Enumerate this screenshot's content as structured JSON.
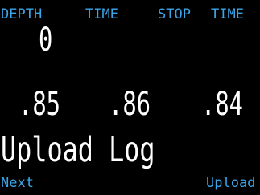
{
  "header": {
    "depth_label": "DEPTH",
    "time_label": "TIME",
    "stop_label": "STOP",
    "time2_label": "TIME"
  },
  "depth": {
    "value": "0"
  },
  "readings": [
    ".85",
    ".86",
    ".84"
  ],
  "message": "Upload Log",
  "softkeys": {
    "left": "Next",
    "right": "Upload"
  },
  "colors": {
    "background": "#000000",
    "label": "#3aa6e8",
    "value": "#ffffff"
  }
}
